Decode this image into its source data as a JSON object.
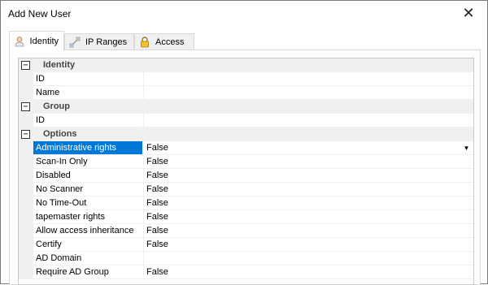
{
  "window": {
    "title": "Add New User"
  },
  "tabs": [
    {
      "label": "Identity",
      "icon": "user-icon",
      "active": true
    },
    {
      "label": "IP Ranges",
      "icon": "ip-ranges-icon",
      "active": false
    },
    {
      "label": "Access",
      "icon": "lock-icon",
      "active": false
    }
  ],
  "grid": {
    "categories": [
      {
        "label": "Identity",
        "toggle": "−",
        "properties": [
          {
            "label": "ID",
            "value": ""
          },
          {
            "label": "Name",
            "value": ""
          }
        ]
      },
      {
        "label": "Group",
        "toggle": "−",
        "properties": [
          {
            "label": "ID",
            "value": ""
          }
        ]
      },
      {
        "label": "Options",
        "toggle": "−",
        "properties": [
          {
            "label": "Administrative rights",
            "value": "False"
          },
          {
            "label": "Scan-In Only",
            "value": "False"
          },
          {
            "label": "Disabled",
            "value": "False"
          },
          {
            "label": "No Scanner",
            "value": "False"
          },
          {
            "label": "No Time-Out",
            "value": "False"
          },
          {
            "label": "tapemaster rights",
            "value": "False"
          },
          {
            "label": "Allow access inheritance",
            "value": "False"
          },
          {
            "label": "Certify",
            "value": "False"
          },
          {
            "label": "AD Domain",
            "value": ""
          },
          {
            "label": "Require AD Group",
            "value": "False"
          }
        ]
      }
    ]
  },
  "colors": {
    "selection": "#0078d7",
    "category_bg": "#f0f0f0"
  }
}
